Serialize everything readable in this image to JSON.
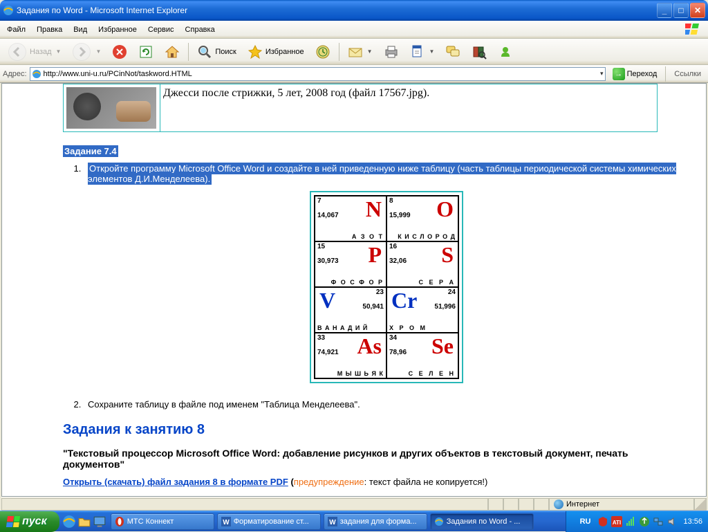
{
  "titlebar": {
    "title": "Задания по Word - Microsoft Internet Explorer"
  },
  "menu": {
    "file": "Файл",
    "edit": "Правка",
    "view": "Вид",
    "fav": "Избранное",
    "tools": "Сервис",
    "help": "Справка"
  },
  "toolbar": {
    "back": "Назад",
    "search": "Поиск",
    "favs": "Избранное"
  },
  "address": {
    "label": "Адрес:",
    "url": "http://www.uni-u.ru/PCinNot/taskword.HTML",
    "go": "Переход",
    "links": "Ссылки"
  },
  "page": {
    "caption": "Джесси после стрижки, 5 лет, 2008 год (файл 17567.jpg).",
    "task74_title": "Задание 7.4",
    "task74_item1": "Откройте программу Microsoft Office Word и создайте в ней приведенную ниже таблицу (часть таблицы периодической системы химических элементов Д.И.Менделеева).",
    "task74_item2": "Сохраните таблицу в файле под именем \"Таблица Менделеева\".",
    "elements": {
      "n": {
        "num": "7",
        "sym": "N",
        "mass": "14,067",
        "name": "А З О Т"
      },
      "o": {
        "num": "8",
        "sym": "O",
        "mass": "15,999",
        "name": "К И С Л О Р О Д"
      },
      "p": {
        "num": "15",
        "sym": "P",
        "mass": "30,973",
        "name": "Ф О С Ф О Р"
      },
      "s": {
        "num": "16",
        "sym": "S",
        "mass": "32,06",
        "name": "С Е Р А"
      },
      "v": {
        "num": "23",
        "sym": "V",
        "mass": "50,941",
        "name": "В А Н А Д И Й"
      },
      "cr": {
        "num": "24",
        "sym": "Cr",
        "mass": "51,996",
        "name": "Х Р О М"
      },
      "as": {
        "num": "33",
        "sym": "As",
        "mass": "74,921",
        "name": "М Ы Ш Ь Я К"
      },
      "se": {
        "num": "34",
        "sym": "Se",
        "mass": "78,96",
        "name": "С Е Л Е Н"
      }
    },
    "h2": "Задания к занятию 8",
    "subhead": "\"Текстовый процессор Microsoft Office Word: добавление рисунков и других объектов в текстовый документ, печать документов\"",
    "link": "Открыть (скачать) файл задания 8 в формате PDF",
    "warn_label": "предупреждение",
    "warn_tail": ": текст файла не копируется!)"
  },
  "status": {
    "zone": "Интернет"
  },
  "taskbar": {
    "start": "пуск",
    "lang": "RU",
    "tasks": [
      {
        "label": "МТС Коннект"
      },
      {
        "label": "Форматирование ст..."
      },
      {
        "label": "задания для форма..."
      },
      {
        "label": "Задания по Word - ..."
      }
    ],
    "clock": "13:56"
  }
}
